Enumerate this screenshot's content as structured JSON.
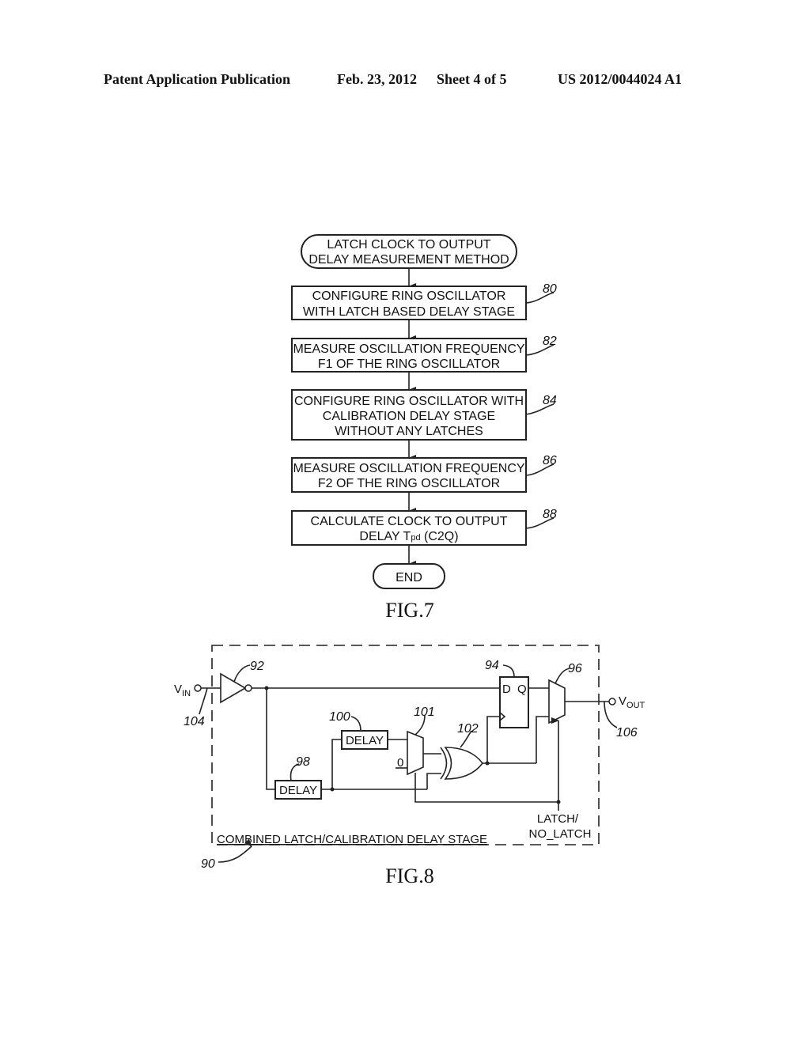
{
  "header": {
    "publication": "Patent Application Publication",
    "date": "Feb. 23, 2012",
    "sheet": "Sheet 4 of 5",
    "number": "US 2012/0044024 A1"
  },
  "fig7": {
    "label": "FIG.7",
    "start": {
      "line1": "LATCH  CLOCK  TO  OUTPUT",
      "line2": "DELAY  MEASUREMENT  METHOD"
    },
    "steps": [
      {
        "ref": "80",
        "lines": [
          "CONFIGURE  RING  OSCILLATOR",
          "WITH  LATCH  BASED  DELAY  STAGE"
        ]
      },
      {
        "ref": "82",
        "lines": [
          "MEASURE  OSCILLATION  FREQUENCY",
          "F1  OF  THE  RING  OSCILLATOR"
        ]
      },
      {
        "ref": "84",
        "lines": [
          "CONFIGURE  RING  OSCILLATOR  WITH",
          "CALIBRATION  DELAY  STAGE",
          "WITHOUT  ANY  LATCHES"
        ]
      },
      {
        "ref": "86",
        "lines": [
          "MEASURE  OSCILLATION  FREQUENCY",
          "F2  OF  THE  RING  OSCILLATOR"
        ]
      },
      {
        "ref": "88",
        "lines": [
          "CALCULATE  CLOCK  TO  OUTPUT",
          "DELAY  T",
          "pd",
          " (C2Q)"
        ]
      }
    ],
    "end": "END"
  },
  "fig8": {
    "label": "FIG.8",
    "stage_label": "COMBINED  LATCH/CALIBRATION  DELAY  STAGE",
    "stage_ref": "90",
    "vin": {
      "main": "V",
      "sub": "IN",
      "ref": "104"
    },
    "vout": {
      "main": "V",
      "sub": "OUT",
      "ref": "106"
    },
    "inverter_ref": "92",
    "flipflop": {
      "ref": "94",
      "d": "D",
      "q": "Q"
    },
    "mux_out_ref": "96",
    "delay1": {
      "ref": "98",
      "label": "DELAY"
    },
    "delay2": {
      "ref": "100",
      "label": "DELAY"
    },
    "mux_in": {
      "ref": "101",
      "zero": "0"
    },
    "xor_ref": "102",
    "control": {
      "line1": "LATCH/",
      "line2": "NO_LATCH"
    }
  }
}
